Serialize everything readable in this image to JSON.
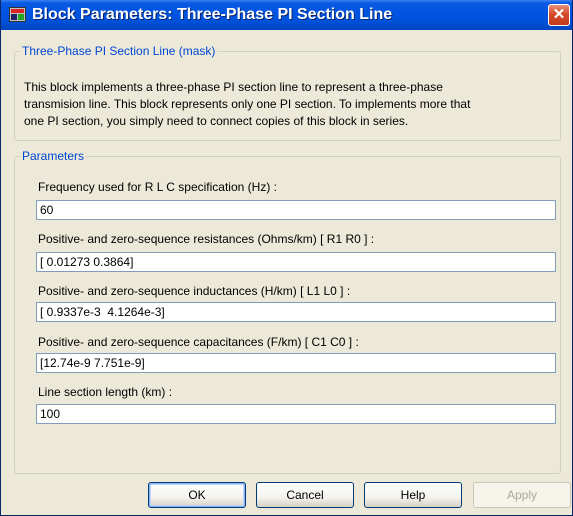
{
  "window": {
    "title": "Block Parameters: Three-Phase PI Section Line",
    "close_glyph": "✕",
    "icon": "simulink-block-icon"
  },
  "mask": {
    "legend": "Three-Phase PI Section Line (mask)",
    "description_lines": [
      "This block implements a three-phase PI section line to represent a three-phase",
      "transmision line. This block represents only  one PI section.  To implements more that",
      "one PI section,  you  simply need to connect  copies of this block in series."
    ]
  },
  "parameters": {
    "legend": "Parameters",
    "fields": [
      {
        "label": "Frequency used for R L C specification (Hz) :",
        "value": "60"
      },
      {
        "label": "Positive- and zero-sequence resistances (Ohms/km)  [ R1  R0 ] :",
        "value": "[ 0.01273 0.3864]"
      },
      {
        "label": "Positive- and zero-sequence inductances (H/km) [ L1  L0 ] :",
        "value": "[ 0.9337e-3  4.1264e-3]"
      },
      {
        "label": "Positive- and zero-sequence capacitances (F/km)  [ C1 C0 ] :",
        "value": "[12.74e-9 7.751e-9]"
      },
      {
        "label": "Line section length (km) :",
        "value": "100"
      }
    ]
  },
  "buttons": {
    "ok": "OK",
    "cancel": "Cancel",
    "help": "Help",
    "apply": "Apply"
  },
  "colors": {
    "titlebar": "#0054e3",
    "legend_text": "#0046d5",
    "dialog_bg": "#ece9d8"
  }
}
